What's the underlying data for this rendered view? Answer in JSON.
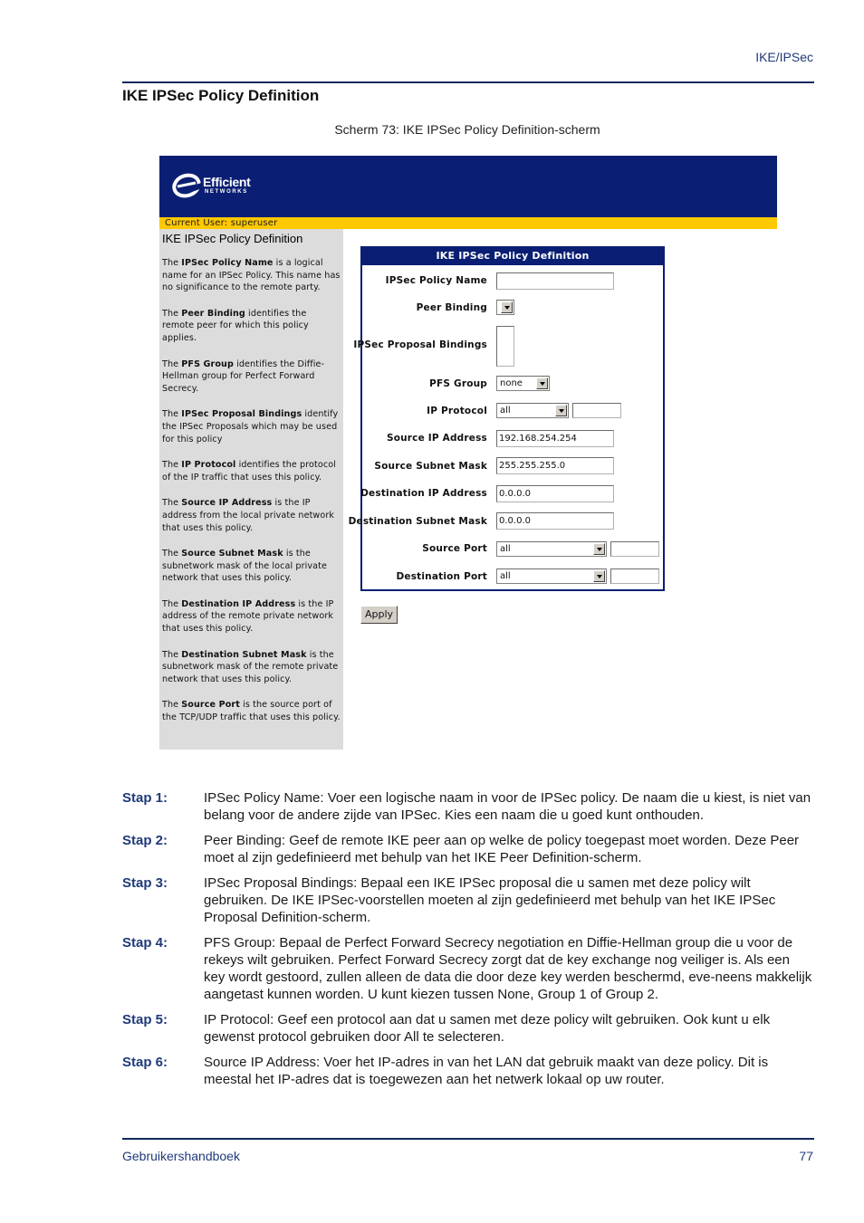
{
  "running_head": "IKE/IPSec",
  "section_title": "IKE IPSec Policy Definition",
  "caption": "Scherm 73: IKE IPSec Policy Definition-scherm",
  "screenshot": {
    "logo": {
      "word": "Efficient",
      "sub": "NETWORKS"
    },
    "current_user": "Current User: superuser",
    "help": {
      "title": "IKE IPSec Policy Definition",
      "paragraphs": [
        {
          "pre": "The ",
          "term": "IPSec Policy Name",
          "post": " is a logical name for an IPSec Policy. This name has no significance to the remote party."
        },
        {
          "pre": "The ",
          "term": "Peer Binding",
          "post": " identifies the remote peer for which this policy applies."
        },
        {
          "pre": "The ",
          "term": "PFS Group",
          "post": " identifies the Diffie-Hellman group for Perfect Forward Secrecy."
        },
        {
          "pre": "The ",
          "term": "IPSec Proposal Bindings",
          "post": " identify the IPSec Proposals which may be used for this policy"
        },
        {
          "pre": "The ",
          "term": "IP Protocol",
          "post": " identifies the protocol of the IP traffic that uses this policy."
        },
        {
          "pre": "The ",
          "term": "Source IP Address",
          "post": " is the IP address from the local private network that uses this policy."
        },
        {
          "pre": "The ",
          "term": "Source Subnet Mask",
          "post": " is the subnetwork mask of the local private network that uses this policy."
        },
        {
          "pre": "The ",
          "term": "Destination IP Address",
          "post": " is the IP address of the remote private network that uses this policy."
        },
        {
          "pre": "The ",
          "term": "Destination Subnet Mask",
          "post": " is the subnetwork mask of the remote private network that uses this policy."
        },
        {
          "pre": "The ",
          "term": "Source Port",
          "post": " is the source port of the TCP/UDP traffic that uses this policy."
        }
      ]
    },
    "form": {
      "title": "IKE IPSec Policy Definition",
      "fields": {
        "policy_name": {
          "label": "IPSec Policy Name",
          "value": ""
        },
        "peer_binding": {
          "label": "Peer Binding",
          "value": ""
        },
        "proposal_bindings": {
          "label": "IPSec Proposal Bindings"
        },
        "pfs_group": {
          "label": "PFS Group",
          "value": "none"
        },
        "ip_protocol": {
          "label": "IP Protocol",
          "value": "all",
          "extra": ""
        },
        "source_ip": {
          "label": "Source IP Address",
          "value": "192.168.254.254"
        },
        "source_mask": {
          "label": "Source Subnet Mask",
          "value": "255.255.255.0"
        },
        "dest_ip": {
          "label": "Destination IP Address",
          "value": "0.0.0.0"
        },
        "dest_mask": {
          "label": "Destination Subnet Mask",
          "value": "0.0.0.0"
        },
        "source_port": {
          "label": "Source Port",
          "value": "all",
          "extra": ""
        },
        "dest_port": {
          "label": "Destination Port",
          "value": "all",
          "extra": ""
        }
      },
      "apply_label": "Apply"
    }
  },
  "steps": [
    {
      "num": "Stap 1:",
      "text": "IPSec Policy Name: Voer een logische naam in voor de IPSec policy. De naam die u kiest, is niet van belang voor de andere zijde van IPSec. Kies een naam die u goed kunt onthouden."
    },
    {
      "num": "Stap 2:",
      "text": "Peer Binding: Geef de remote IKE peer aan op welke de policy toegepast moet worden. Deze Peer moet al zijn gedefinieerd met behulp van het IKE Peer Definition-scherm."
    },
    {
      "num": "Stap 3:",
      "text": "IPSec Proposal Bindings: Bepaal een IKE IPSec proposal die u samen met deze policy wilt gebruiken. De IKE IPSec-voorstellen moeten al zijn gedefinieerd met behulp van het IKE IPSec Proposal Definition-scherm."
    },
    {
      "num": "Stap 4:",
      "text": "PFS Group: Bepaal de Perfect Forward Secrecy negotiation en Diffie-Hellman group die u voor de rekeys wilt gebruiken. Perfect Forward Secrecy zorgt dat de key exchange nog veiliger is. Als een key wordt gestoord, zullen alleen de data die door deze key werden beschermd, eve-neens makkelijk aangetast kunnen worden. U kunt kiezen tussen None, Group 1 of Group 2."
    },
    {
      "num": "Stap 5:",
      "text": "IP Protocol: Geef een protocol aan dat u samen met deze policy wilt gebruiken. Ook kunt u elk gewenst protocol gebruiken door All te selecteren."
    },
    {
      "num": "Stap 6:",
      "text": "Source IP Address: Voer het IP-adres in van het LAN dat gebruik maakt van deze policy. Dit is meestal het IP-adres dat is toegewezen aan het netwerk lokaal op uw router."
    }
  ],
  "footer": {
    "left": "Gebruikershandboek",
    "right": "77"
  }
}
